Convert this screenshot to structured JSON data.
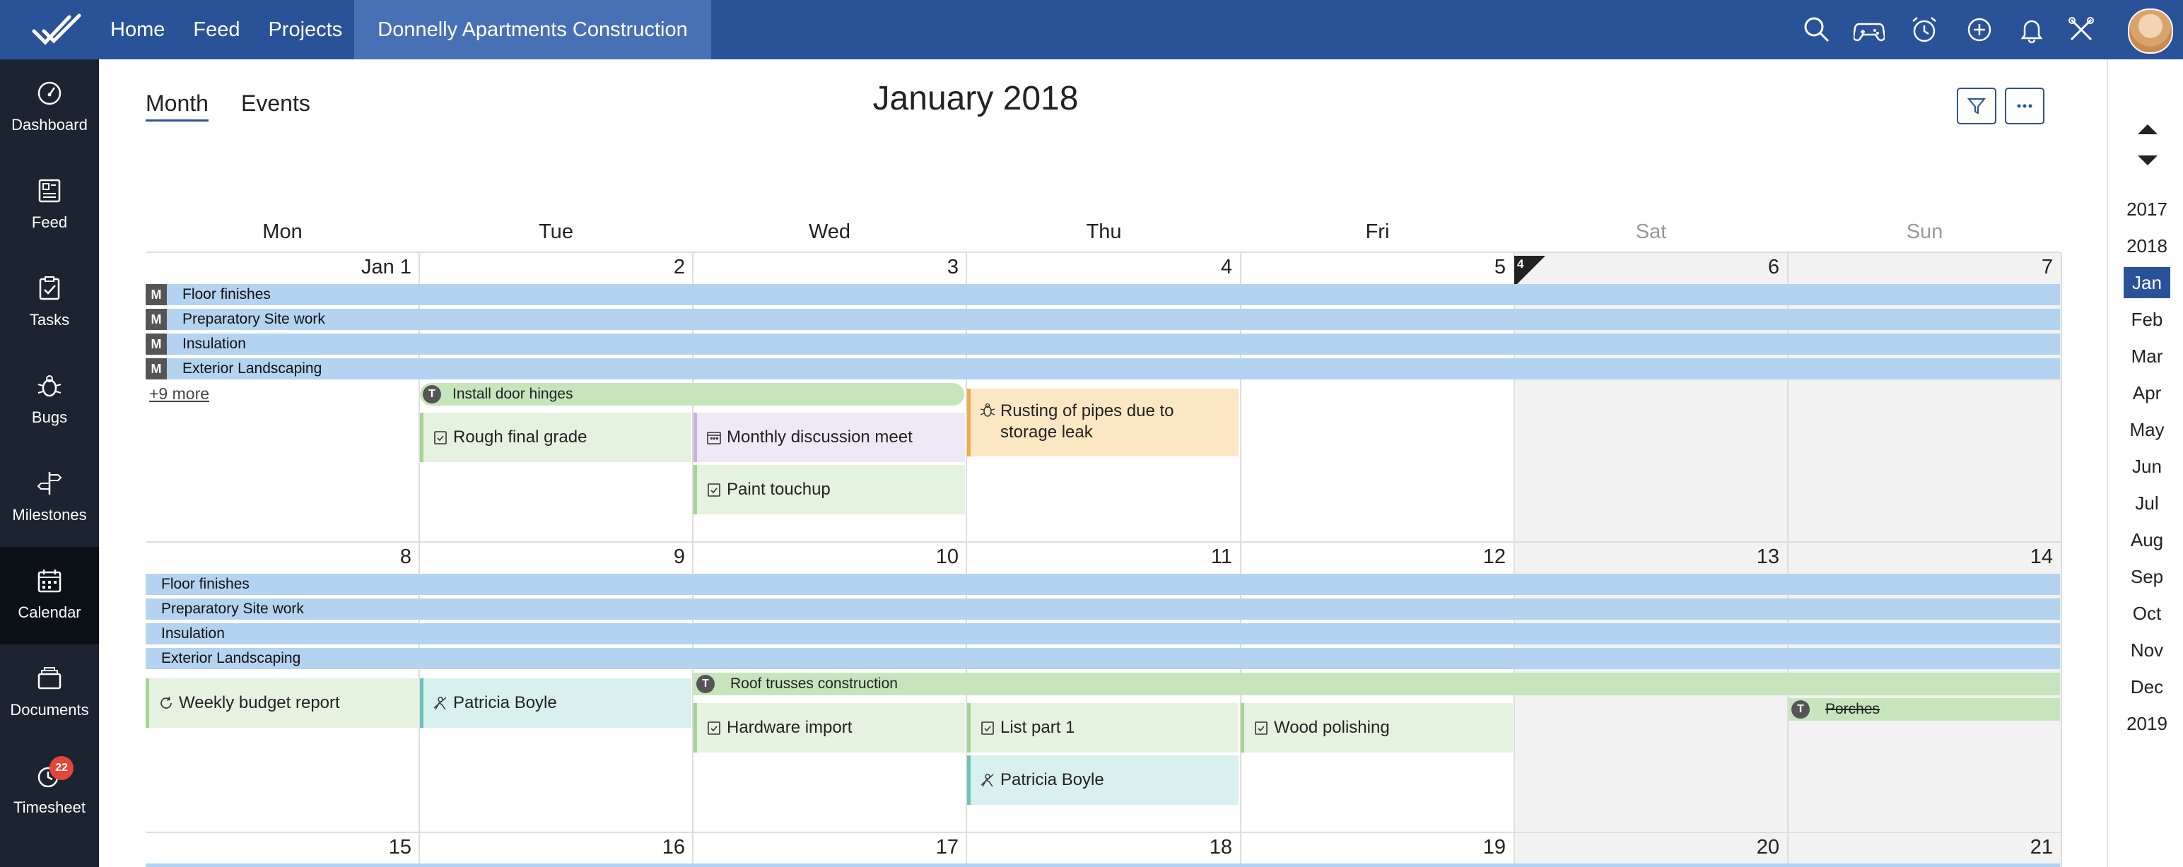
{
  "nav": {
    "home": "Home",
    "feed": "Feed",
    "projects": "Projects",
    "current_project": "Donnelly Apartments Construction"
  },
  "topicons": [
    "search-icon",
    "gamepad-icon",
    "alarm-clock-icon",
    "plus-circle-icon",
    "bell-icon",
    "tools-icon"
  ],
  "sidebar": [
    {
      "label": "Dashboard",
      "icon": "dashboard-icon"
    },
    {
      "label": "Feed",
      "icon": "feed-icon"
    },
    {
      "label": "Tasks",
      "icon": "tasks-icon"
    },
    {
      "label": "Bugs",
      "icon": "bug-icon"
    },
    {
      "label": "Milestones",
      "icon": "milestone-signpost-icon"
    },
    {
      "label": "Calendar",
      "icon": "calendar-icon",
      "active": true
    },
    {
      "label": "Documents",
      "icon": "documents-icon"
    },
    {
      "label": "Timesheet",
      "icon": "timesheet-icon",
      "badge": "22"
    }
  ],
  "header": {
    "tab_month": "Month",
    "tab_events": "Events",
    "title": "January 2018"
  },
  "days_of_week": [
    "Mon",
    "Tue",
    "Wed",
    "Thu",
    "Fri",
    "Sat",
    "Sun"
  ],
  "week1": {
    "days": [
      "Jan 1",
      "2",
      "3",
      "4",
      "5",
      "6",
      "7"
    ],
    "week_number": "4",
    "milestones": [
      "Floor finishes",
      "Preparatory Site work",
      "Insulation",
      "Exterior Landscaping"
    ],
    "milestone_tag": "M",
    "more": "+9 more",
    "task_bar": {
      "tag": "T",
      "label": "Install door hinges"
    },
    "events": {
      "rough_final_grade": "Rough final grade",
      "monthly_discussion": "Monthly discussion meet",
      "paint_touchup": "Paint touchup",
      "rusting_pipes_line1": "Rusting of pipes due to",
      "rusting_pipes_line2": "storage leak"
    }
  },
  "week2": {
    "days": [
      "8",
      "9",
      "10",
      "11",
      "12",
      "13",
      "14"
    ],
    "milestones": [
      "Floor finishes",
      "Preparatory Site work",
      "Insulation",
      "Exterior Landscaping"
    ],
    "task_bar": {
      "tag": "T",
      "label": "Roof trusses construction"
    },
    "porches": {
      "tag": "T",
      "label": "Porches"
    },
    "events": {
      "weekly_budget": "Weekly budget report",
      "patricia_tue": "Patricia Boyle",
      "hardware_import": "Hardware import",
      "list_part_1": "List part 1",
      "wood_polishing": "Wood polishing",
      "patricia_thu": "Patricia Boyle"
    }
  },
  "week3": {
    "days": [
      "15",
      "16",
      "17",
      "18",
      "19",
      "20",
      "21"
    ]
  },
  "rail": {
    "years_before": [
      "2017",
      "2018"
    ],
    "months": [
      "Jan",
      "Feb",
      "Mar",
      "Apr",
      "May",
      "Jun",
      "Jul",
      "Aug",
      "Sep",
      "Oct",
      "Nov",
      "Dec"
    ],
    "active_month": "Jan",
    "year_after": "2019"
  }
}
